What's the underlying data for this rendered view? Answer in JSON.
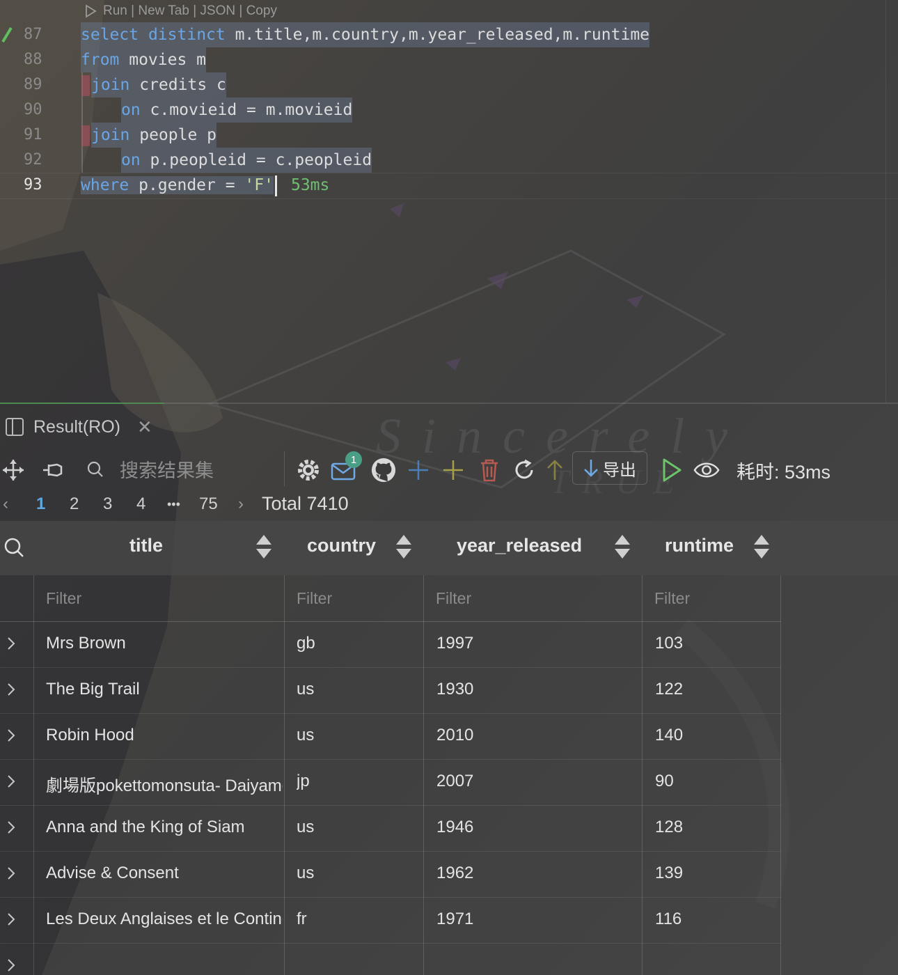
{
  "editor": {
    "codelens": "Run | New Tab | JSON | Copy",
    "lines": [
      {
        "num": "87"
      },
      {
        "num": "88"
      },
      {
        "num": "89"
      },
      {
        "num": "90"
      },
      {
        "num": "91"
      },
      {
        "num": "92"
      },
      {
        "num": "93"
      }
    ],
    "tokens": {
      "l87_kw1": "select",
      "l87_kw2": "distinct",
      "l87_rest": " m.title,m.country,m.year_released,m.runtime",
      "l88_kw": "from",
      "l88_rest": " movies m",
      "l89_kw": "join",
      "l89_rest": " credits c",
      "l90_kw": "on",
      "l90_rest": " c.movieid = m.movieid",
      "l91_kw": "join",
      "l91_rest": " people p",
      "l92_kw": "on",
      "l92_rest": " p.peopleid = c.peopleid",
      "l93_kw": "where",
      "l93_rest": " p.gender = ",
      "l93_str": "'F'",
      "timing": "53ms"
    }
  },
  "result": {
    "tab_label": "Result(RO)",
    "search_placeholder": "搜索结果集",
    "notification_count": "1",
    "export_label": "导出",
    "elapsed": "耗时: 53ms",
    "pager": {
      "pages": [
        "1",
        "2",
        "3",
        "4",
        "•••",
        "75"
      ],
      "active": "1",
      "total": "Total 7410"
    },
    "columns": [
      "title",
      "country",
      "year_released",
      "runtime"
    ],
    "filter_placeholder": "Filter",
    "rows": [
      [
        "Mrs Brown",
        "gb",
        "1997",
        "103"
      ],
      [
        "The Big Trail",
        "us",
        "1930",
        "122"
      ],
      [
        "Robin Hood",
        "us",
        "2010",
        "140"
      ],
      [
        "劇場版pokettomonsuta- Daiyamondo&Pāru",
        "jp",
        "2007",
        "90"
      ],
      [
        "Anna and the King of Siam",
        "us",
        "1946",
        "128"
      ],
      [
        "Advise & Consent",
        "us",
        "1962",
        "139"
      ],
      [
        "Les Deux Anglaises et le Continent",
        "fr",
        "1971",
        "116"
      ],
      [
        "",
        "",
        "",
        ""
      ]
    ]
  },
  "colors": {
    "keyword": "#6aa6e6",
    "string": "#c6d9a0",
    "timing": "#6fbf73",
    "accent": "#5fa8e0",
    "tab_active": "#4f8a52"
  }
}
